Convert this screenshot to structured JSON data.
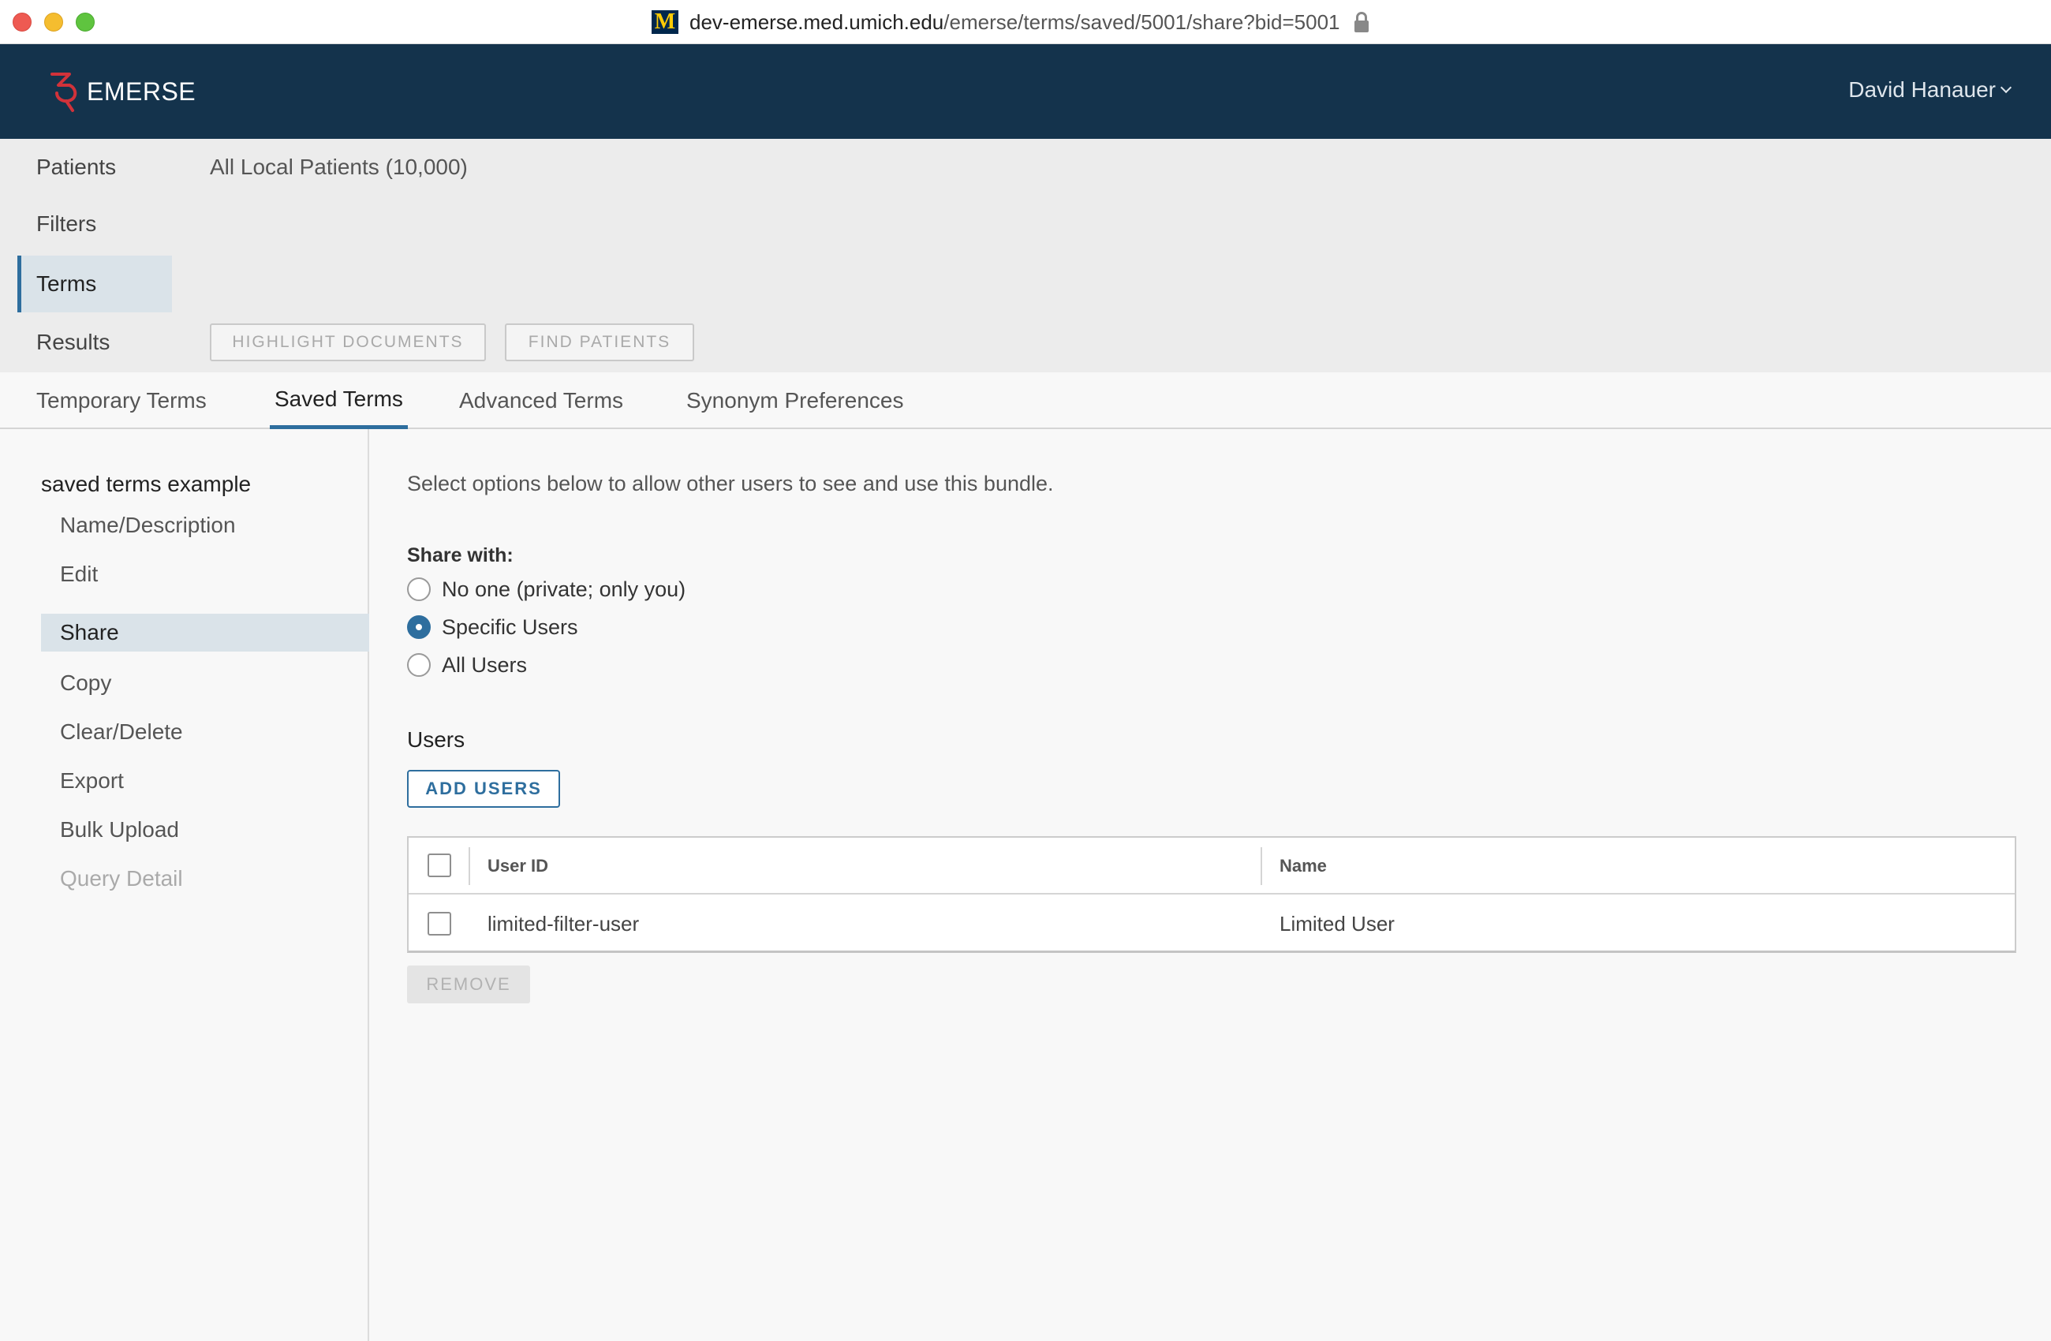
{
  "browser": {
    "favicon_letter": "M",
    "url_host": "dev-emerse.med.umich.edu",
    "url_path": "/emerse/terms/saved/5001/share?bid=5001"
  },
  "header": {
    "app_name": "EMERSE",
    "user_name": "David Hanauer",
    "logo_color": "#d1323a",
    "bar_color": "#14334c"
  },
  "steps": {
    "items": [
      {
        "label": "Patients"
      },
      {
        "label": "Filters"
      },
      {
        "label": "Terms"
      },
      {
        "label": "Results"
      }
    ],
    "active": "Terms",
    "patients_value": "All Local Patients (10,000)",
    "highlight_button": "HIGHLIGHT DOCUMENTS",
    "find_button": "FIND PATIENTS"
  },
  "tabs": {
    "items": [
      {
        "label": "Temporary Terms"
      },
      {
        "label": "Saved Terms"
      },
      {
        "label": "Advanced Terms"
      },
      {
        "label": "Synonym Preferences"
      }
    ],
    "active": "Saved Terms"
  },
  "sidebar": {
    "bundle_title": "saved terms example",
    "items": [
      {
        "label": "Name/Description"
      },
      {
        "label": "Edit"
      },
      {
        "label": "Share"
      },
      {
        "label": "Copy"
      },
      {
        "label": "Clear/Delete"
      },
      {
        "label": "Export"
      },
      {
        "label": "Bulk Upload"
      },
      {
        "label": "Query Detail"
      }
    ],
    "active": "Share",
    "disabled": "Query Detail"
  },
  "share": {
    "intro": "Select options below to allow other users to see and use this bundle.",
    "share_with_label": "Share with:",
    "options": [
      {
        "label": "No one (private; only you)",
        "checked": false
      },
      {
        "label": "Specific Users",
        "checked": true
      },
      {
        "label": "All Users",
        "checked": false
      }
    ],
    "accent_color": "#2e6e9e"
  },
  "users": {
    "heading": "Users",
    "add_button": "ADD USERS",
    "columns": [
      "User ID",
      "Name"
    ],
    "rows": [
      {
        "user_id": "limited-filter-user",
        "name": "Limited User",
        "selected": false
      }
    ],
    "remove_button": "REMOVE"
  }
}
